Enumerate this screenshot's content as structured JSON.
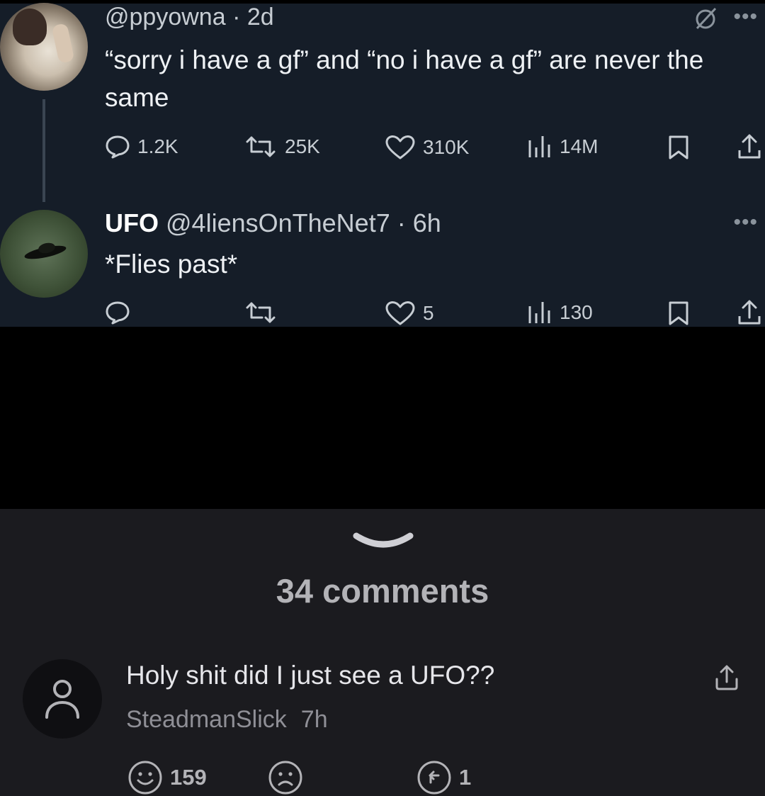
{
  "tweet1": {
    "handle": "@ppyowna",
    "time": "2d",
    "text": "“sorry i have a gf” and “no i have a gf” are never the same",
    "replies": "1.2K",
    "retweets": "25K",
    "likes": "310K",
    "views": "14M"
  },
  "tweet2": {
    "name": "UFO",
    "handle": "@4liensOnTheNet7",
    "time": "6h",
    "text": "*Flies past*",
    "likes": "5",
    "views": "130"
  },
  "comments_section": {
    "title": "34 comments",
    "comment": {
      "text": "Holy shit did I just see a UFO??",
      "author": "SteadmanSlick",
      "time": "7h",
      "likes": "159",
      "replies": "1"
    }
  },
  "colors": {
    "tweet_bg": "#151d28",
    "comments_bg": "#1b1b1f",
    "text_primary": "#eef1f4",
    "text_muted": "#c7cdd3"
  }
}
